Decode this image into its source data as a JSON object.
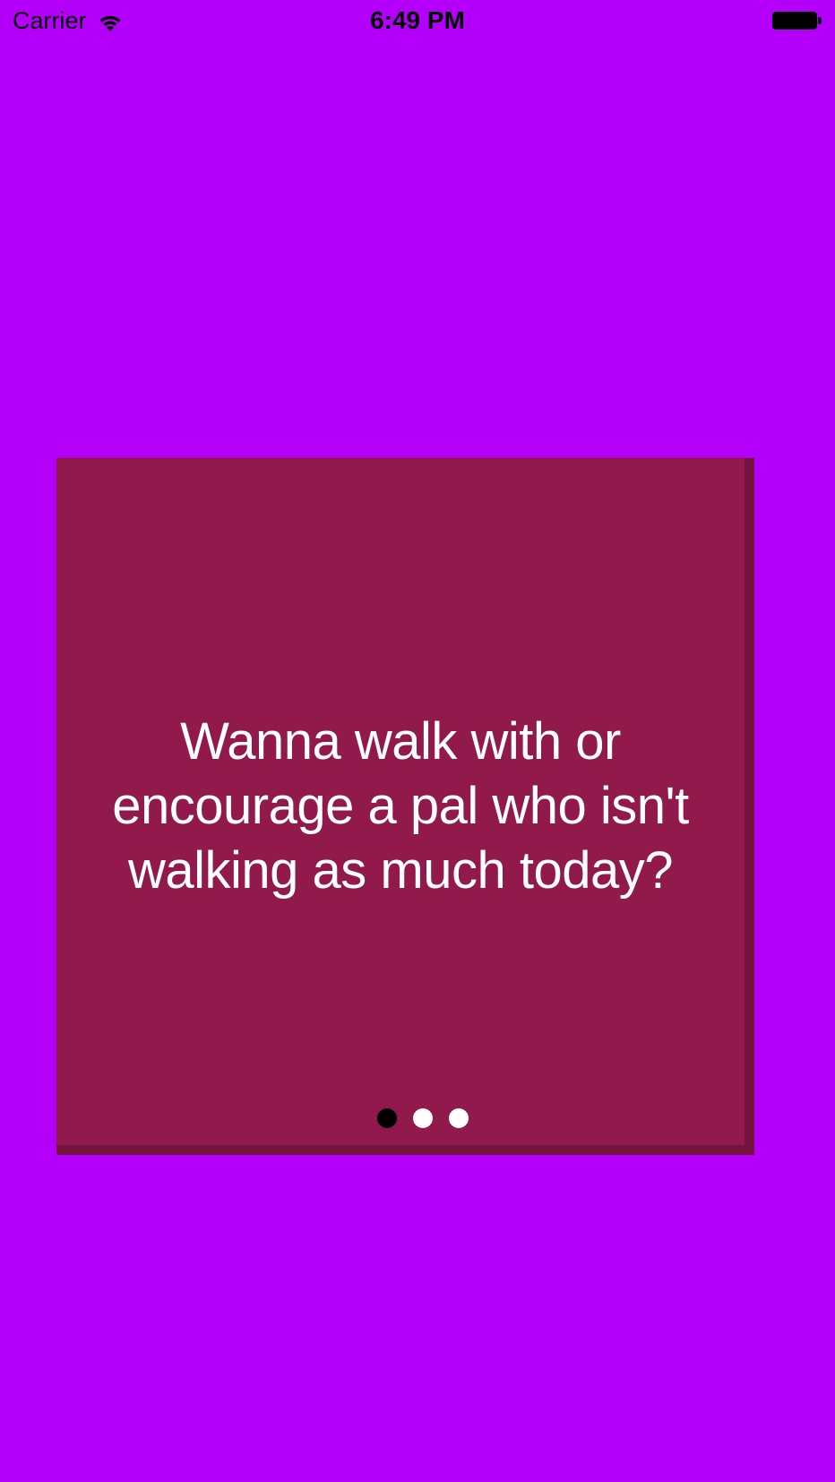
{
  "status_bar": {
    "carrier": "Carrier",
    "time": "6:49 PM",
    "wifi_icon": "wifi-icon",
    "battery_icon": "battery-icon"
  },
  "card": {
    "text": "Wanna walk with or encourage a pal who isn't walking as much today?",
    "page_count": 3,
    "current_page": 1
  },
  "colors": {
    "background": "#b400fa",
    "card": "#91194c",
    "card_shadow": "#74143e",
    "active_dot": "#000000",
    "inactive_dot": "#ffffff"
  }
}
